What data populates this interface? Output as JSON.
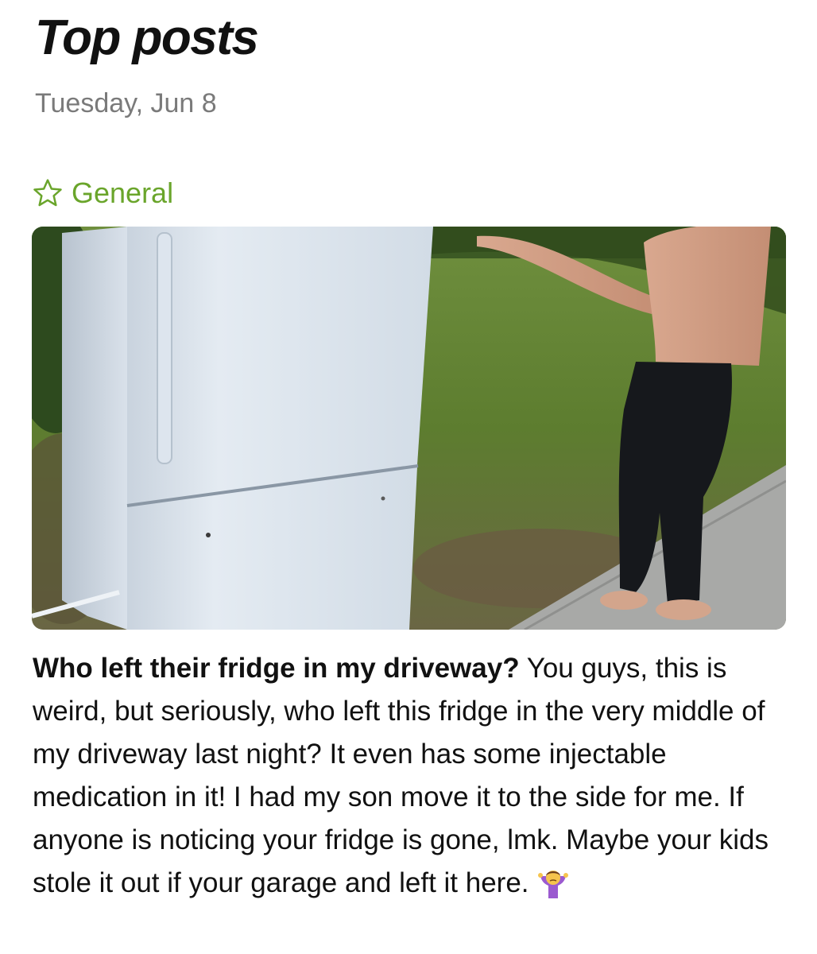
{
  "header": {
    "title": "Top posts",
    "date": "Tuesday, Jun 8"
  },
  "category": {
    "icon": "star-outline-icon",
    "label": "General",
    "color": "#6aa52b"
  },
  "post": {
    "image": "photo-fridge-in-driveway",
    "title": "Who left their fridge in my driveway?",
    "body": "You guys, this is weird, but seriously, who left this fridge in the very middle of my driveway last night?  It even has some injectable medication in it! I had my son move it to the side for me. If anyone is noticing your fridge is gone, lmk. Maybe your kids stole it out if your garage and left it here.",
    "emoji": "person-shrugging-emoji"
  }
}
